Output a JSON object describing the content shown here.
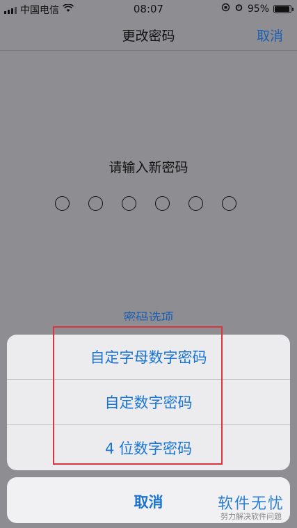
{
  "status_bar": {
    "carrier": "中国电信",
    "time": "08:07",
    "battery": "95%"
  },
  "nav": {
    "title": "更改密码",
    "cancel": "取消"
  },
  "prompt": "请输入新密码",
  "passcode_dots": 6,
  "options_peek": "密码选项",
  "action_sheet": {
    "items": [
      "自定字母数字密码",
      "自定数字密码",
      "4 位数字密码"
    ],
    "cancel": "取消"
  },
  "watermark": {
    "title": "软件无忧",
    "subtitle": "努力解决软件问题"
  },
  "colors": {
    "accent": "#1a74d2",
    "highlight": "#e0323c"
  }
}
